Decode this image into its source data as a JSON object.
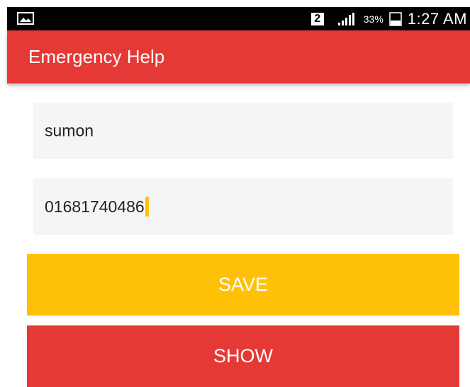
{
  "status_bar": {
    "sim_slot": "2",
    "battery_percent": "33%",
    "time": "1:27 AM",
    "left_icon": "image-icon",
    "signal_icon": "signal-icon",
    "battery_icon": "battery-icon"
  },
  "app_bar": {
    "title": "Emergency Help",
    "color": "#e53935"
  },
  "form": {
    "name_value": "sumon",
    "phone_value": "01681740486"
  },
  "buttons": {
    "save_label": "SAVE",
    "save_color": "#ffc107",
    "show_label": "SHOW",
    "show_color": "#e53935"
  }
}
